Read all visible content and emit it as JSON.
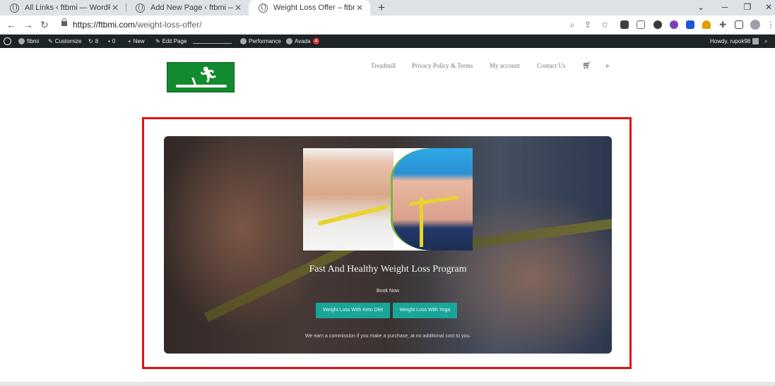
{
  "browser": {
    "tabs": [
      {
        "title": "All Links ‹ ftbmi — WordPress",
        "close": "✕"
      },
      {
        "title": "Add New Page ‹ ftbmi — WordPress",
        "close": "✕"
      },
      {
        "title": "Weight Loss Offer – ftbmi",
        "close": "✕"
      }
    ],
    "new_tab": "+",
    "window_controls": {
      "tab_search": "⌄",
      "minimize": "─",
      "restore": "❐",
      "close": "✕"
    },
    "url_host": "https://ftbmi.com",
    "url_path": "/weight-loss-offer/"
  },
  "admin_bar": {
    "site_name": "ftbmi",
    "customize": "Customize",
    "updates_count": "8",
    "comments_count": "0",
    "new": "New",
    "edit_page": "Edit Page",
    "performance": "Performance",
    "avada": "Avada",
    "avada_badge": "4",
    "howdy": "Howdy, rupok98"
  },
  "site": {
    "nav": [
      "Treadmill",
      "Privacy Policy & Terms",
      "My account",
      "Contact Us"
    ],
    "hero_title": "Fast And Healthy Weight Loss Program",
    "book_now": "Book Now",
    "cta_keto": "Weight Loss With Keto Diet",
    "cta_yoga": "Weight Loss With Yoga",
    "disclaimer": "We earn a commission if you make a purchase, at no additional cost to you."
  },
  "colors": {
    "highlight_border": "#e41212",
    "cta": "#1aa59a",
    "admin_bar": "#1d2327",
    "logo": "#128a2e"
  }
}
